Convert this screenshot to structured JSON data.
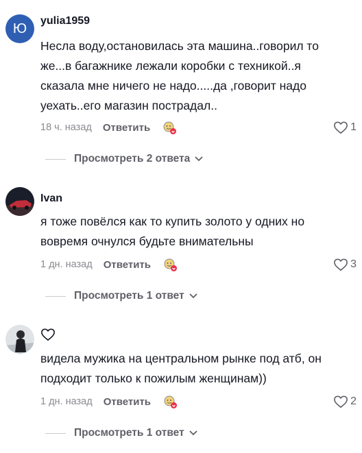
{
  "comments": [
    {
      "avatar_letter": "Ю",
      "username": "yulia1959",
      "text_lines": [
        "Несла воду,остановилась эта машина..говорил то",
        "же...в багажнике лежали коробки с техникой..я",
        "сказала мне ничего не надо.....да ,говорит надо",
        "уехать..его магазин пострадал.."
      ],
      "time": "18 ч. назад",
      "reply_label": "Ответить",
      "likes": "1",
      "view_replies": "Просмотреть 2 ответа"
    },
    {
      "username": "Ivan",
      "text_lines": [
        "я тоже повёлся как то купить золото у одних но",
        "вовремя очнулся будьте внимательны"
      ],
      "time": "1 дн. назад",
      "reply_label": "Ответить",
      "likes": "3",
      "view_replies": "Просмотреть 1 ответ"
    },
    {
      "username": "",
      "text_lines": [
        "видела мужика на центральном рынке под атб, он",
        "подходит только к пожилым женщинам))"
      ],
      "time": "1 дн. назад",
      "reply_label": "Ответить",
      "likes": "2",
      "view_replies": "Просмотреть 1 ответ"
    }
  ],
  "icons": {
    "like": "heart-outline-icon",
    "expand": "chevron-down-icon",
    "sticker": "sticker-icon"
  },
  "colors": {
    "avatar_bg": "#2f5fb3",
    "sticker_badge": "#e8304a",
    "muted": "#8a8b91"
  }
}
